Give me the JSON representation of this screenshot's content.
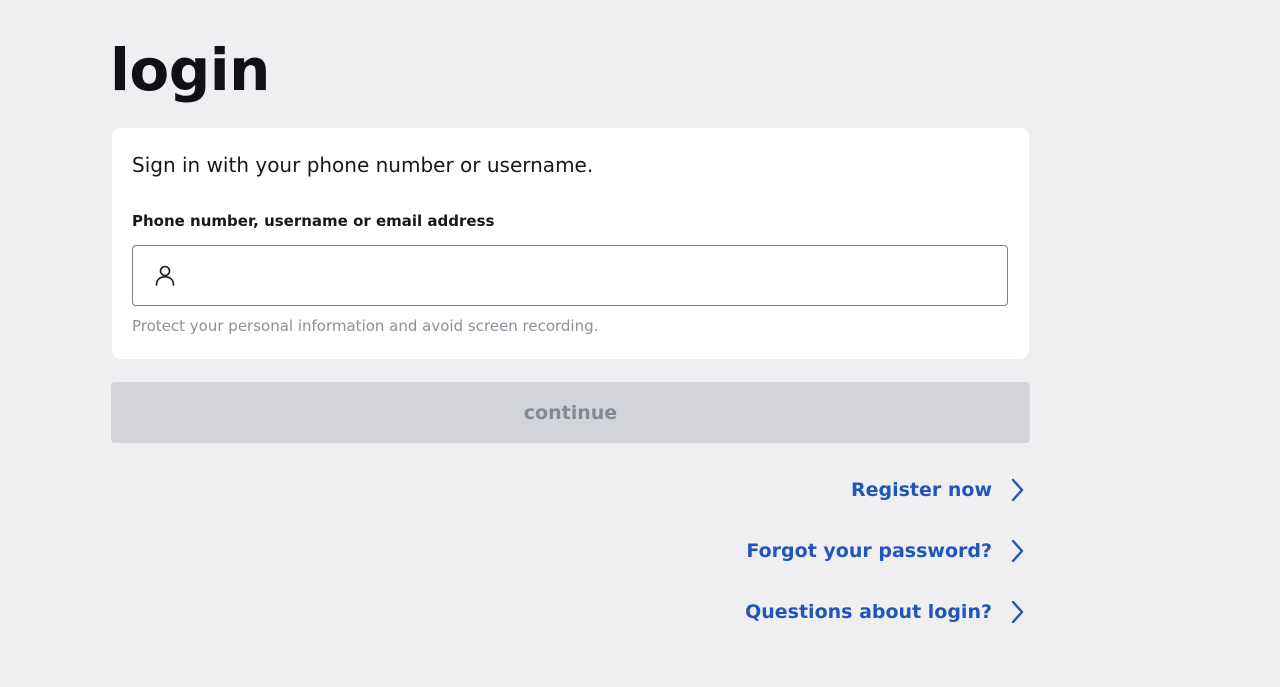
{
  "header": {
    "title": "login"
  },
  "card": {
    "intro": "Sign in with your phone number or username.",
    "field_label": "Phone number, username or email address",
    "input_value": "",
    "input_placeholder": "",
    "input_icon": "user-icon",
    "hint": "Protect your personal information and avoid screen recording."
  },
  "actions": {
    "continue_label": "continue",
    "continue_enabled": false
  },
  "links": [
    {
      "label": "Register now",
      "icon": "chevron-right-icon"
    },
    {
      "label": "Forgot your password?",
      "icon": "chevron-right-icon"
    },
    {
      "label": "Questions about login?",
      "icon": "chevron-right-icon"
    }
  ],
  "colors": {
    "background": "#efeff2",
    "card": "#ffffff",
    "link": "#1f56b8",
    "button_disabled_bg": "#d3d4d9",
    "button_disabled_text": "#858993"
  }
}
